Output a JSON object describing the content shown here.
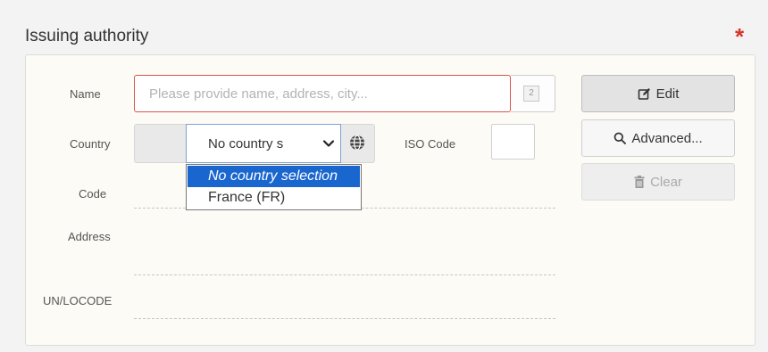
{
  "section": {
    "title": "Issuing authority",
    "required_mark": "*"
  },
  "fields": {
    "name_label": "Name",
    "name_placeholder": "Please provide name, address, city...",
    "name_counter": "2",
    "country_label": "Country",
    "country_selected": "No country s",
    "iso_label": "ISO Code",
    "code_label": "Code",
    "address_label": "Address",
    "unlocode_label": "UN/LOCODE"
  },
  "dropdown": {
    "options": [
      "No country selection",
      "France (FR)"
    ],
    "selected_index": 0
  },
  "buttons": {
    "edit": "Edit",
    "advanced": "Advanced...",
    "clear": "Clear"
  },
  "colors": {
    "required": "#d9342b",
    "error_border": "#d9534f",
    "selection": "#1a66cf"
  },
  "icons": [
    "edit-icon",
    "search-icon",
    "trash-icon",
    "globe-icon",
    "chevron-down-icon"
  ]
}
